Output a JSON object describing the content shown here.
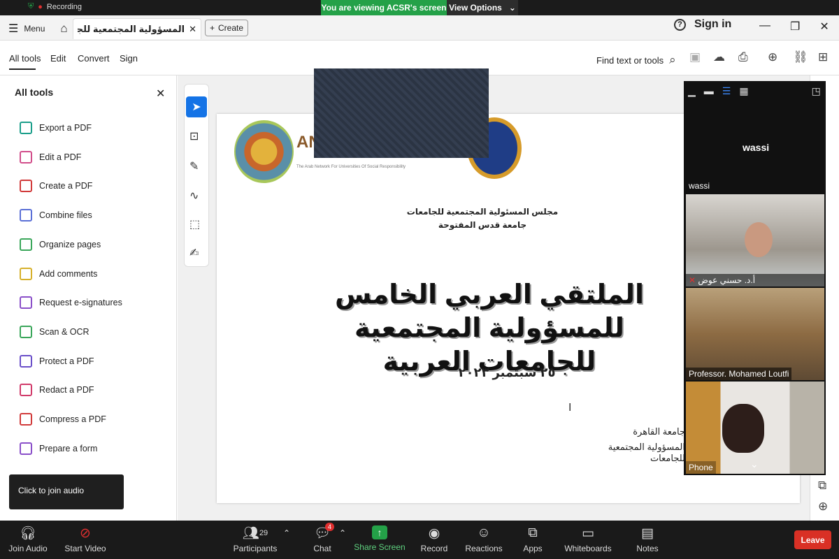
{
  "zoom_bar": {
    "recording_label": "Recording",
    "viewing_text": "You are viewing ACSR's screen",
    "view_options": "View Options",
    "signin_small": "Sign in",
    "view_small": "View"
  },
  "tab": {
    "menu_label": "Menu",
    "title": "المسؤولية المجتمعية للجامعات...",
    "create_label": "Create",
    "signin_label": "Sign in"
  },
  "acrobat_nav": {
    "items": [
      "All tools",
      "Edit",
      "Convert",
      "Sign"
    ],
    "find_text": "Find text or tools"
  },
  "left_panel": {
    "heading": "All tools",
    "tools": [
      {
        "label": "Export a PDF",
        "color": "#1a9e8a"
      },
      {
        "label": "Edit a PDF",
        "color": "#d14d8a"
      },
      {
        "label": "Create a PDF",
        "color": "#d13a3a"
      },
      {
        "label": "Combine files",
        "color": "#5a6fd6"
      },
      {
        "label": "Organize pages",
        "color": "#3aa65a"
      },
      {
        "label": "Add comments",
        "color": "#d6b02a"
      },
      {
        "label": "Request e-signatures",
        "color": "#8a4fc9"
      },
      {
        "label": "Scan & OCR",
        "color": "#3aa65a"
      },
      {
        "label": "Protect a PDF",
        "color": "#6a4fc9"
      },
      {
        "label": "Redact a PDF",
        "color": "#d13a6a"
      },
      {
        "label": "Compress a PDF",
        "color": "#d13a3a"
      },
      {
        "label": "Prepare a form",
        "color": "#8a4fc9"
      }
    ],
    "tooltip": "Click to join audio"
  },
  "document": {
    "logo_text": "AN",
    "logo_sub": "The Arab Network For Universities Of Social Responsibility",
    "council": "مجلس المسئولية المجتمعية للجامعات",
    "university": "جامعة قدس المفتوحة",
    "title_line1": "الملتقي العربي الخامس للمسؤولية المجتمعية",
    "title_line2": "للجامعات العربية",
    "date": "٢٥ سبتمبر ٢٠٢٣",
    "cairo_line1": "جامعة القاهرة",
    "cairo_line2": "المسؤولية المجتمعية للجامعات"
  },
  "video_panel": {
    "wassi_name": "wassi",
    "wassi_label": "wassi",
    "participants": [
      {
        "name": "أ.د. حسني عوض"
      },
      {
        "name": "Professor. Mohamed Loutfi"
      },
      {
        "name": "Phone"
      }
    ]
  },
  "bottom_bar": {
    "join_audio": "Join Audio",
    "start_video": "Start Video",
    "participants": "Participants",
    "participants_count": "29",
    "chat": "Chat",
    "chat_badge": "4",
    "share_screen": "Share Screen",
    "record": "Record",
    "reactions": "Reactions",
    "apps": "Apps",
    "whiteboards": "Whiteboards",
    "notes": "Notes",
    "leave": "Leave",
    "share_color": "#24a148",
    "leave_color": "#d93025"
  }
}
